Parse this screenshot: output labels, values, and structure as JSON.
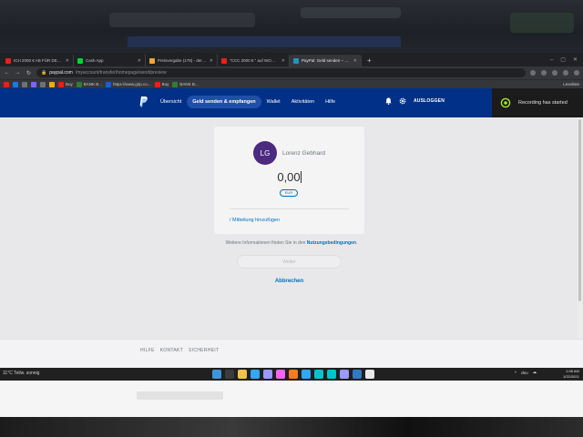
{
  "browser": {
    "tabs": [
      {
        "label": "ICH 2000 € AB FÜR DEN BESTEN M...",
        "favicon_color": "#e62117",
        "active": false
      },
      {
        "label": "Cash App",
        "favicon_color": "#00d632",
        "active": false
      },
      {
        "label": "Preisvergabe (178) - derstandgro...",
        "favicon_color": "#f1a33b",
        "active": false
      },
      {
        "label": "\"CCC 2000 € \" auf WOW bis nächs...",
        "favicon_color": "#e62117",
        "active": false
      },
      {
        "label": "PayPal: Geld senden – Bezahlun...",
        "favicon_color": "#2790c3",
        "active": true
      }
    ],
    "address": {
      "host": "paypal.com",
      "path": "/myaccount/transfer/homepage/send/preview"
    },
    "bookmarks": [
      {
        "label": "",
        "color": "#e62117"
      },
      {
        "label": "",
        "color": "#1877f2"
      },
      {
        "label": "",
        "color": "#6c7378"
      },
      {
        "label": "",
        "color": "#7b68ee"
      },
      {
        "label": "",
        "color": "#6c7378"
      },
      {
        "label": "",
        "color": "#f5a623"
      },
      {
        "label": "Buy",
        "color": "#e62117"
      },
      {
        "label": "BANK B...",
        "color": "#2e7d32"
      },
      {
        "label": "https://www.g2p.co...",
        "color": "#1565c0"
      },
      {
        "label": "Buy",
        "color": "#e62117"
      },
      {
        "label": "BANK B...",
        "color": "#2e7d32"
      }
    ],
    "bookmarks_right": "Leseliste"
  },
  "paypal": {
    "nav": [
      {
        "label": "Übersicht",
        "active": false
      },
      {
        "label": "Geld senden & empfangen",
        "active": true
      },
      {
        "label": "Wallet",
        "active": false
      },
      {
        "label": "Aktivitäten",
        "active": false
      },
      {
        "label": "Hilfe",
        "active": false
      }
    ],
    "logout": "AUSLOGGEN",
    "recording": "Recording has started",
    "payee_initials": "LG",
    "payee_name": "Lorenz Gebhard",
    "amount": "0,00",
    "currency": "EUR",
    "note_link": "/ Mitteilung hinzufügen",
    "info_text": "Weitere Informationen finden Sie in den ",
    "info_link": "Nutzungsbedingungen",
    "info_end": ".",
    "next_button": "Weiter",
    "cancel": "Abbrechen",
    "footer_links": [
      "HILFE",
      "KONTAKT",
      "SICHERHEIT"
    ]
  },
  "taskbar": {
    "weather": "11°C Teilw. sonnig",
    "apps": [
      "#3a96dd",
      "#3c3c3c",
      "#f0c14b",
      "#31a8ff",
      "#9999ff",
      "#ff61f6",
      "#f57c1f",
      "#31a8ff",
      "#00c4cc",
      "#00c4cc",
      "#9999ff",
      "#3178c6",
      "#e8e8e8"
    ],
    "tray": [
      "^",
      "deu",
      "☁"
    ],
    "time": "1:06 AM",
    "date": "1/22/2021"
  },
  "colors": {
    "paypal_blue": "#003087",
    "link_blue": "#0070ba",
    "avatar": "#4b2a7f"
  }
}
